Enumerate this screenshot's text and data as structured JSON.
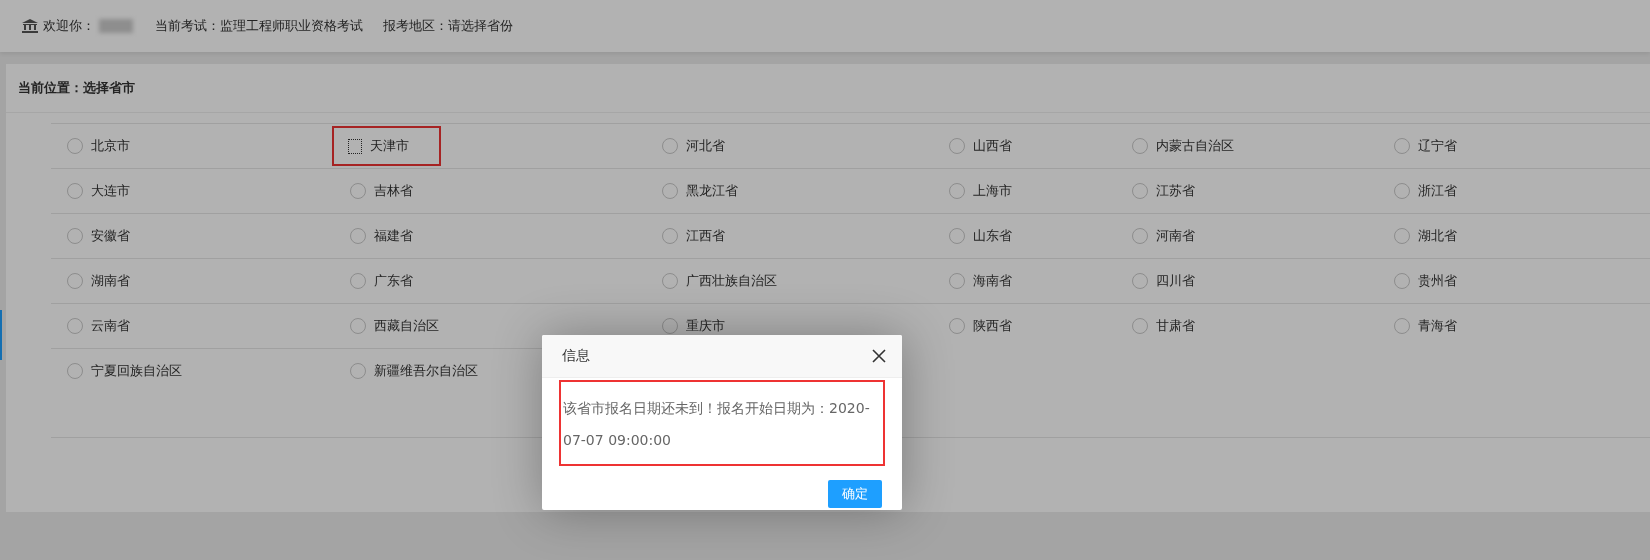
{
  "header": {
    "welcome": "欢迎你：",
    "exam": "当前考试：监理工程师职业资格考试",
    "region": "报考地区：请选择省份"
  },
  "breadcrumb": "当前位置：选择省市",
  "regions": [
    {
      "label": "北京市",
      "selected": false,
      "focused": false,
      "highlighted": false
    },
    {
      "label": "天津市",
      "selected": false,
      "focused": true,
      "highlighted": true
    },
    {
      "label": "河北省",
      "selected": false,
      "focused": false,
      "highlighted": false
    },
    {
      "label": "山西省",
      "selected": false,
      "focused": false,
      "highlighted": false
    },
    {
      "label": "内蒙古自治区",
      "selected": false,
      "focused": false,
      "highlighted": false
    },
    {
      "label": "辽宁省",
      "selected": false,
      "focused": false,
      "highlighted": false
    },
    {
      "label": "大连市",
      "selected": false,
      "focused": false,
      "highlighted": false
    },
    {
      "label": "吉林省",
      "selected": false,
      "focused": false,
      "highlighted": false
    },
    {
      "label": "黑龙江省",
      "selected": false,
      "focused": false,
      "highlighted": false
    },
    {
      "label": "上海市",
      "selected": false,
      "focused": false,
      "highlighted": false
    },
    {
      "label": "江苏省",
      "selected": false,
      "focused": false,
      "highlighted": false
    },
    {
      "label": "浙江省",
      "selected": false,
      "focused": false,
      "highlighted": false
    },
    {
      "label": "安徽省",
      "selected": false,
      "focused": false,
      "highlighted": false
    },
    {
      "label": "福建省",
      "selected": false,
      "focused": false,
      "highlighted": false
    },
    {
      "label": "江西省",
      "selected": false,
      "focused": false,
      "highlighted": false
    },
    {
      "label": "山东省",
      "selected": false,
      "focused": false,
      "highlighted": false
    },
    {
      "label": "河南省",
      "selected": false,
      "focused": false,
      "highlighted": false
    },
    {
      "label": "湖北省",
      "selected": false,
      "focused": false,
      "highlighted": false
    },
    {
      "label": "湖南省",
      "selected": false,
      "focused": false,
      "highlighted": false
    },
    {
      "label": "广东省",
      "selected": false,
      "focused": false,
      "highlighted": false
    },
    {
      "label": "广西壮族自治区",
      "selected": false,
      "focused": false,
      "highlighted": false
    },
    {
      "label": "海南省",
      "selected": false,
      "focused": false,
      "highlighted": false
    },
    {
      "label": "四川省",
      "selected": false,
      "focused": false,
      "highlighted": false
    },
    {
      "label": "贵州省",
      "selected": false,
      "focused": false,
      "highlighted": false
    },
    {
      "label": "云南省",
      "selected": false,
      "focused": false,
      "highlighted": false
    },
    {
      "label": "西藏自治区",
      "selected": false,
      "focused": false,
      "highlighted": false
    },
    {
      "label": "重庆市",
      "selected": false,
      "focused": false,
      "highlighted": false
    },
    {
      "label": "陕西省",
      "selected": false,
      "focused": false,
      "highlighted": false
    },
    {
      "label": "甘肃省",
      "selected": false,
      "focused": false,
      "highlighted": false
    },
    {
      "label": "青海省",
      "selected": false,
      "focused": false,
      "highlighted": false
    },
    {
      "label": "宁夏回族自治区",
      "selected": false,
      "focused": false,
      "highlighted": false
    },
    {
      "label": "新疆维吾尔自治区",
      "selected": false,
      "focused": false,
      "highlighted": false
    }
  ],
  "dialog": {
    "title": "信息",
    "message": "该省市报名日期还未到！报名开始日期为：2020-07-07 09:00:00",
    "message_highlighted": true,
    "button": "确定"
  }
}
